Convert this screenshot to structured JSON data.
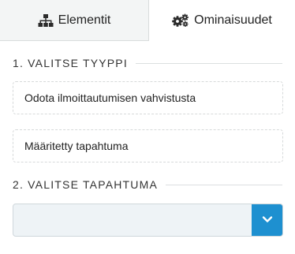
{
  "tabs": {
    "elements": {
      "label": "Elementit",
      "icon": "sitemap-icon"
    },
    "properties": {
      "label": "Ominaisuudet",
      "icon": "cogs-icon",
      "active": true
    }
  },
  "sections": {
    "type": {
      "heading": "1. VALITSE TYYPPI",
      "options": [
        {
          "label": "Odota ilmoittautumisen vahvistusta"
        },
        {
          "label": "Määritetty tapahtuma"
        }
      ]
    },
    "event": {
      "heading": "2. VALITSE TAPAHTUMA",
      "select": {
        "value": "",
        "icon": "chevron-down-icon"
      }
    }
  },
  "colors": {
    "accent": "#1e90d0",
    "select_bg": "#eef3f6",
    "inactive_tab_bg": "#f3f5f5"
  }
}
